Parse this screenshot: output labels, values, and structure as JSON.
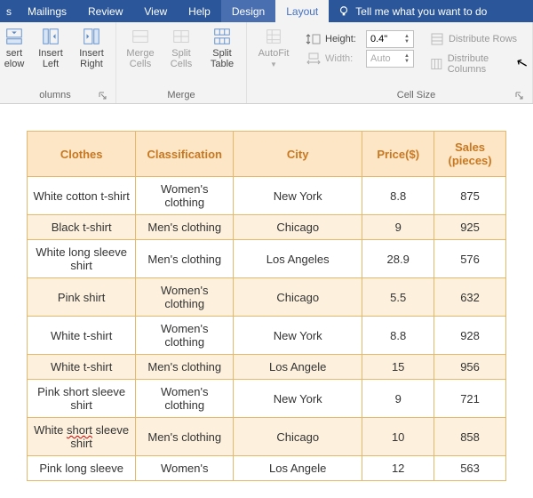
{
  "tabs": {
    "list": [
      {
        "label": "s"
      },
      {
        "label": "Mailings"
      },
      {
        "label": "Review"
      },
      {
        "label": "View"
      },
      {
        "label": "Help"
      },
      {
        "label": "Design"
      },
      {
        "label": "Layout"
      }
    ],
    "active_index": 6,
    "tell_me": "Tell me what you want to do"
  },
  "ribbon": {
    "rows_cols_group": {
      "label": "olumns",
      "insert_below_l1": "sert",
      "insert_below_l2": "elow",
      "insert_left_l1": "Insert",
      "insert_left_l2": "Left",
      "insert_right_l1": "Insert",
      "insert_right_l2": "Right"
    },
    "merge_group": {
      "label": "Merge",
      "merge_cells_l1": "Merge",
      "merge_cells_l2": "Cells",
      "split_cells_l1": "Split",
      "split_cells_l2": "Cells",
      "split_table_l1": "Split",
      "split_table_l2": "Table"
    },
    "autofit_group": {
      "autofit": "AutoFit"
    },
    "cellsize_group": {
      "label": "Cell Size",
      "height_label": "Height:",
      "height_value": "0.4\"",
      "width_label": "Width:",
      "width_value": "Auto",
      "dist_rows": "Distribute Rows",
      "dist_cols": "Distribute Columns"
    }
  },
  "table": {
    "headers": [
      "Clothes",
      "Classification",
      "City",
      "Price($)",
      "Sales (pieces)"
    ],
    "rows": [
      [
        "White cotton t-shirt",
        "Women's clothing",
        "New York",
        "8.8",
        "875"
      ],
      [
        "Black t-shirt",
        "Men's clothing",
        "Chicago",
        "9",
        "925"
      ],
      [
        "White long sleeve shirt",
        "Men's clothing",
        "Los Angeles",
        "28.9",
        "576"
      ],
      [
        "Pink shirt",
        "Women's clothing",
        "Chicago",
        "5.5",
        "632"
      ],
      [
        "White t-shirt",
        "Women's clothing",
        "New York",
        "8.8",
        "928"
      ],
      [
        "White t-shirt",
        "Men's clothing",
        "Los Angele",
        "15",
        "956"
      ],
      [
        "Pink short sleeve shirt",
        "Women's clothing",
        "New York",
        "9",
        "721"
      ],
      [
        "White short sleeve shirt",
        "Men's clothing",
        "Chicago",
        "10",
        "858"
      ],
      [
        "Pink long sleeve",
        "Women's",
        "Los Angele",
        "12",
        "563"
      ]
    ]
  }
}
